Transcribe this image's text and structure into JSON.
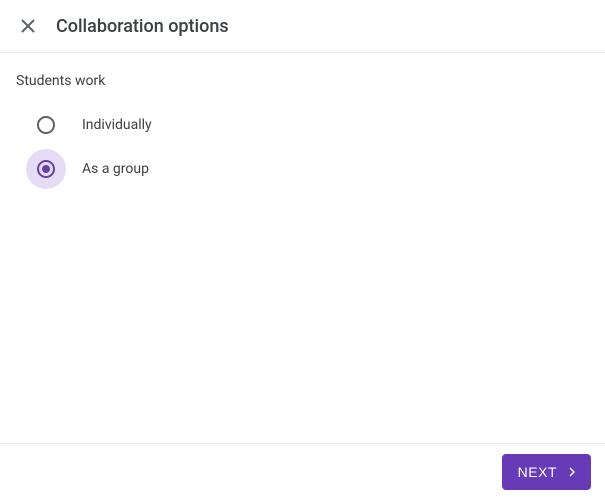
{
  "header": {
    "title": "Collaboration options"
  },
  "section": {
    "label": "Students work"
  },
  "options": {
    "individually": {
      "label": "Individually",
      "selected": false
    },
    "group": {
      "label": "As a group",
      "selected": true
    }
  },
  "footer": {
    "next_label": "NEXT"
  },
  "colors": {
    "accent": "#673ab7"
  }
}
